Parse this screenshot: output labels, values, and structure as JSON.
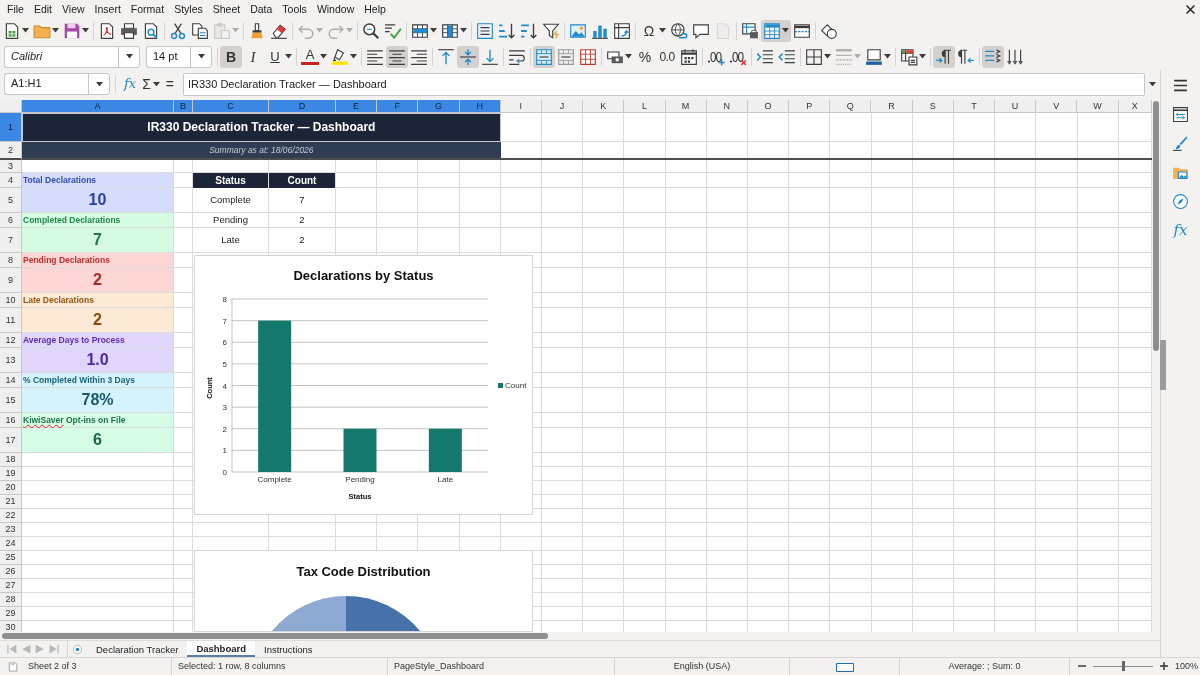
{
  "menu_bar": [
    "File",
    "Edit",
    "View",
    "Insert",
    "Format",
    "Styles",
    "Sheet",
    "Data",
    "Tools",
    "Window",
    "Help"
  ],
  "standard_toolbar": [
    [
      {
        "kind": "new",
        "menu": true,
        "pressed": false,
        "disabled": false
      },
      {
        "kind": "open",
        "menu": true,
        "pressed": false,
        "disabled": false
      },
      {
        "kind": "save",
        "menu": true,
        "pressed": false,
        "disabled": false
      }
    ],
    [
      {
        "kind": "pdf",
        "menu": false,
        "pressed": false,
        "disabled": false
      },
      {
        "kind": "print",
        "menu": false,
        "pressed": false,
        "disabled": false
      },
      {
        "kind": "preview",
        "menu": false,
        "pressed": false,
        "disabled": false
      }
    ],
    [
      {
        "kind": "cut",
        "menu": false,
        "pressed": false,
        "disabled": false
      },
      {
        "kind": "copy",
        "menu": false,
        "pressed": false,
        "disabled": false
      },
      {
        "kind": "paste",
        "menu": true,
        "pressed": false,
        "disabled": true
      }
    ],
    [
      {
        "kind": "clone",
        "menu": false,
        "pressed": false,
        "disabled": false
      },
      {
        "kind": "clear",
        "menu": false,
        "pressed": false,
        "disabled": false
      }
    ],
    [
      {
        "kind": "undo",
        "menu": true,
        "pressed": false,
        "disabled": true
      },
      {
        "kind": "redo",
        "menu": true,
        "pressed": false,
        "disabled": true
      }
    ],
    [
      {
        "kind": "find",
        "menu": false,
        "pressed": false,
        "disabled": false
      },
      {
        "kind": "spelling",
        "menu": false,
        "pressed": false,
        "disabled": false
      }
    ],
    [
      {
        "kind": "row",
        "menu": true,
        "pressed": false,
        "disabled": false
      },
      {
        "kind": "column",
        "menu": true,
        "pressed": false,
        "disabled": false
      }
    ],
    [
      {
        "kind": "sort",
        "menu": false,
        "pressed": false,
        "disabled": false
      },
      {
        "kind": "ascending",
        "menu": false,
        "pressed": false,
        "disabled": false
      },
      {
        "kind": "descending",
        "menu": false,
        "pressed": false,
        "disabled": false
      },
      {
        "kind": "autofilter",
        "menu": false,
        "pressed": false,
        "disabled": false
      }
    ],
    [
      {
        "kind": "image",
        "menu": false,
        "pressed": false,
        "disabled": false
      },
      {
        "kind": "chart",
        "menu": false,
        "pressed": false,
        "disabled": false
      },
      {
        "kind": "pivot",
        "menu": false,
        "pressed": false,
        "disabled": false
      }
    ],
    [
      {
        "kind": "special",
        "glyph": "Ω",
        "menu": true,
        "pressed": false,
        "disabled": false
      },
      {
        "kind": "hyperlink",
        "menu": false,
        "pressed": false,
        "disabled": false
      },
      {
        "kind": "comment",
        "menu": false,
        "pressed": false,
        "disabled": false
      },
      {
        "kind": "headerfooter",
        "menu": false,
        "pressed": false,
        "disabled": true
      }
    ],
    [
      {
        "kind": "printarea",
        "menu": false,
        "pressed": false,
        "disabled": false
      },
      {
        "kind": "freeze",
        "menu": true,
        "pressed": true,
        "disabled": false
      },
      {
        "kind": "split",
        "menu": false,
        "pressed": false,
        "disabled": false
      }
    ],
    [
      {
        "kind": "shapes",
        "menu": false,
        "pressed": false,
        "disabled": false
      }
    ]
  ],
  "formatting_toolbar": {
    "font_name": "Calibri",
    "font_size": "14 pt",
    "groups": [
      [
        {
          "kind": "bold",
          "glyph": "B",
          "menu": false,
          "pressed": true,
          "disabled": false
        },
        {
          "kind": "italic",
          "glyph": "I",
          "menu": false,
          "pressed": false,
          "disabled": false
        },
        {
          "kind": "underline",
          "glyph": "U",
          "menu": true,
          "pressed": false,
          "disabled": false
        }
      ],
      [
        {
          "kind": "fontcolor",
          "glyph": "A",
          "menu": true,
          "pressed": false,
          "disabled": false
        },
        {
          "kind": "highlight",
          "menu": true,
          "pressed": false,
          "disabled": false
        }
      ],
      [
        {
          "kind": "left",
          "menu": false,
          "pressed": false,
          "disabled": false
        },
        {
          "kind": "center",
          "menu": false,
          "pressed": true,
          "disabled": false
        },
        {
          "kind": "right",
          "menu": false,
          "pressed": false,
          "disabled": false
        }
      ],
      [
        {
          "kind": "top",
          "menu": false,
          "pressed": false,
          "disabled": false
        },
        {
          "kind": "middle",
          "menu": false,
          "pressed": true,
          "disabled": false
        },
        {
          "kind": "bottom",
          "menu": false,
          "pressed": false,
          "disabled": false
        }
      ],
      [
        {
          "kind": "wrap",
          "menu": false,
          "pressed": false,
          "disabled": false
        }
      ],
      [
        {
          "kind": "mergecenter",
          "menu": false,
          "pressed": true,
          "disabled": false
        },
        {
          "kind": "merge",
          "menu": false,
          "pressed": false,
          "disabled": false
        },
        {
          "kind": "unmerge",
          "menu": false,
          "pressed": false,
          "disabled": false
        }
      ],
      [
        {
          "kind": "currency",
          "menu": true,
          "pressed": false,
          "disabled": false
        },
        {
          "kind": "percent",
          "glyph": "%",
          "menu": false,
          "pressed": false,
          "disabled": false
        },
        {
          "kind": "standard",
          "glyph": "0.0",
          "menu": false,
          "pressed": false,
          "disabled": false
        },
        {
          "kind": "date",
          "menu": false,
          "pressed": false,
          "disabled": false
        }
      ],
      [
        {
          "kind": "adddecimal",
          "menu": false,
          "pressed": false,
          "disabled": false
        },
        {
          "kind": "deldecimal",
          "menu": false,
          "pressed": false,
          "disabled": false
        }
      ],
      [
        {
          "kind": "indent",
          "menu": false,
          "pressed": false,
          "disabled": false
        },
        {
          "kind": "outdent",
          "menu": false,
          "pressed": false,
          "disabled": false
        }
      ],
      [
        {
          "kind": "borders",
          "menu": true,
          "pressed": false,
          "disabled": false
        },
        {
          "kind": "borderstyle",
          "menu": true,
          "pressed": false,
          "disabled": true
        },
        {
          "kind": "bordercolor",
          "menu": true,
          "pressed": false,
          "disabled": false
        }
      ],
      [
        {
          "kind": "conditional",
          "menu": true,
          "pressed": false,
          "disabled": false
        }
      ],
      [
        {
          "kind": "ltr",
          "menu": false,
          "pressed": true,
          "disabled": false
        },
        {
          "kind": "rtl",
          "menu": false,
          "pressed": false,
          "disabled": false
        }
      ],
      [
        {
          "kind": "vertical",
          "menu": false,
          "pressed": true,
          "disabled": false
        },
        {
          "kind": "stacked",
          "menu": false,
          "pressed": false,
          "disabled": false
        }
      ]
    ]
  },
  "formula_bar": {
    "name_box": "A1:H1",
    "function_wizard": "fx",
    "sum": "Σ",
    "equals": "=",
    "content": "IR330 Declaration Tracker — Dashboard"
  },
  "sidebar": [
    {
      "kind": "menu"
    },
    {
      "kind": "properties"
    },
    {
      "kind": "styles"
    },
    {
      "kind": "gallery"
    },
    {
      "kind": "navigator"
    },
    {
      "kind": "functions",
      "glyph": "fx"
    }
  ],
  "sheet": {
    "columns": [
      {
        "label": "A",
        "selected": true
      },
      {
        "label": "B",
        "selected": true
      },
      {
        "label": "C",
        "selected": true
      },
      {
        "label": "D",
        "selected": true
      },
      {
        "label": "E",
        "selected": true
      },
      {
        "label": "F",
        "selected": true
      },
      {
        "label": "G",
        "selected": true
      },
      {
        "label": "H",
        "selected": true
      },
      {
        "label": "I",
        "selected": false
      },
      {
        "label": "J",
        "selected": false
      },
      {
        "label": "K",
        "selected": false
      },
      {
        "label": "L",
        "selected": false
      },
      {
        "label": "M",
        "selected": false
      },
      {
        "label": "N",
        "selected": false
      },
      {
        "label": "O",
        "selected": false
      },
      {
        "label": "P",
        "selected": false
      },
      {
        "label": "Q",
        "selected": false
      },
      {
        "label": "R",
        "selected": false
      },
      {
        "label": "S",
        "selected": false
      },
      {
        "label": "T",
        "selected": false
      },
      {
        "label": "U",
        "selected": false
      },
      {
        "label": "V",
        "selected": false
      },
      {
        "label": "W",
        "selected": false
      },
      {
        "label": "X",
        "selected": false
      }
    ],
    "rows": [
      {
        "label": "1",
        "selected": true
      },
      {
        "label": "2",
        "selected": false
      },
      {
        "label": "3",
        "selected": false
      },
      {
        "label": "4",
        "selected": false
      },
      {
        "label": "5",
        "selected": false
      },
      {
        "label": "6",
        "selected": false
      },
      {
        "label": "7",
        "selected": false
      },
      {
        "label": "8",
        "selected": false
      },
      {
        "label": "9",
        "selected": false
      },
      {
        "label": "10",
        "selected": false
      },
      {
        "label": "11",
        "selected": false
      },
      {
        "label": "12",
        "selected": false
      },
      {
        "label": "13",
        "selected": false
      },
      {
        "label": "14",
        "selected": false
      },
      {
        "label": "15",
        "selected": false
      },
      {
        "label": "16",
        "selected": false
      },
      {
        "label": "17",
        "selected": false
      },
      {
        "label": "18",
        "selected": false
      },
      {
        "label": "19",
        "selected": false
      },
      {
        "label": "20",
        "selected": false
      },
      {
        "label": "21",
        "selected": false
      },
      {
        "label": "22",
        "selected": false
      },
      {
        "label": "23",
        "selected": false
      },
      {
        "label": "24",
        "selected": false
      },
      {
        "label": "25",
        "selected": false
      },
      {
        "label": "26",
        "selected": false
      },
      {
        "label": "27",
        "selected": false
      },
      {
        "label": "28",
        "selected": false
      },
      {
        "label": "29",
        "selected": false
      },
      {
        "label": "30",
        "selected": false
      }
    ],
    "title": {
      "text": "IR330 Declaration Tracker — Dashboard",
      "selected": true
    },
    "subtitle": "Summary as at: 18/06/2026",
    "kpis": [
      {
        "label": "Total Declarations",
        "value": "10",
        "color": "#2f4cbb",
        "misspelled": false
      },
      {
        "label": "Completed Declarations",
        "value": "7",
        "color": "#23874a",
        "misspelled": false
      },
      {
        "label": "Pending Declarations",
        "value": "2",
        "color": "#c0302a",
        "misspelled": false
      },
      {
        "label": "Late Declarations",
        "value": "2",
        "color": "#98560f",
        "misspelled": false
      },
      {
        "label": "Average Days to Process",
        "value": "1.0",
        "color": "#5a30b0",
        "misspelled": false
      },
      {
        "label": "% Completed Within 3 Days",
        "value": "78%",
        "color": "#1c6579",
        "misspelled": false
      },
      {
        "label": "KiwiSaver Opt-ins on File",
        "value": "6",
        "color": "#1d7648",
        "misspelled": true
      }
    ],
    "status_table": {
      "columns": [
        "Status",
        "Count"
      ],
      "rows": [
        [
          "Complete",
          "7"
        ],
        [
          "Pending",
          "2"
        ],
        [
          "Late",
          "2"
        ]
      ]
    },
    "charts": [
      {
        "kind": "bar",
        "chart_data": {
          "type": "bar",
          "title": "Declarations by Status",
          "xlabel": "Status",
          "ylabel": "Count",
          "categories": [
            "Complete",
            "Pending",
            "Late"
          ],
          "series": [
            {
              "name": "Count",
              "color": "#14786c",
              "values": [
                7,
                2,
                2
              ]
            }
          ],
          "ylim": [
            0,
            8
          ],
          "yticks": [
            0,
            1,
            2,
            3,
            4,
            5,
            6,
            7,
            8
          ],
          "grid": true
        }
      },
      {
        "kind": "pie",
        "title": "Tax Code Distribution"
      }
    ]
  },
  "sheet_tabs": [
    {
      "label": "Declaration Tracker",
      "selected": false
    },
    {
      "label": "Dashboard",
      "selected": true
    },
    {
      "label": "Instructions",
      "selected": false
    }
  ],
  "status_bar": {
    "sheet": "Sheet 2 of 3",
    "selection": "Selected: 1 row, 8 columns",
    "page_style": "PageStyle_Dashboard",
    "language": "English (USA)",
    "summary": "Average: ; Sum: 0",
    "zoom_slider": {
      "level": 0.5
    },
    "zoom": "100%"
  }
}
